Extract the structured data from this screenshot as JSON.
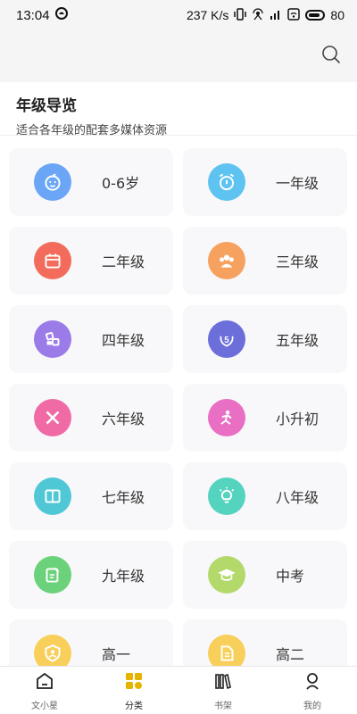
{
  "status_bar": {
    "time": "13:04",
    "net_speed": "237 K/s",
    "battery": "80"
  },
  "header": {
    "title": "年级导览",
    "subtitle": "适合各年级的配套多媒体资源"
  },
  "grades": [
    {
      "label": "0-6岁",
      "icon": "baby-face-icon",
      "color": "#6aa6f5"
    },
    {
      "label": "一年级",
      "icon": "alarm-clock-icon",
      "color": "#5ec3f0"
    },
    {
      "label": "二年级",
      "icon": "calendar-icon",
      "color": "#f26b5b"
    },
    {
      "label": "三年级",
      "icon": "group-people-icon",
      "color": "#f6a15f"
    },
    {
      "label": "四年级",
      "icon": "blocks-icon",
      "color": "#9b7be8"
    },
    {
      "label": "五年级",
      "icon": "laurel-five-icon",
      "color": "#6c6fd9"
    },
    {
      "label": "六年级",
      "icon": "pencil-ruler-icon",
      "color": "#f06aa6"
    },
    {
      "label": "小升初",
      "icon": "running-figure-icon",
      "color": "#e96fc4"
    },
    {
      "label": "七年级",
      "icon": "book-icon",
      "color": "#4fc7d4"
    },
    {
      "label": "八年级",
      "icon": "lightbulb-icon",
      "color": "#54d3bf"
    },
    {
      "label": "九年级",
      "icon": "note-pen-icon",
      "color": "#6bd17a"
    },
    {
      "label": "中考",
      "icon": "graduation-cap-icon",
      "color": "#b3d96a"
    },
    {
      "label": "高一",
      "icon": "shield-person-icon",
      "color": "#f8cf5a"
    },
    {
      "label": "高二",
      "icon": "document-icon",
      "color": "#f8cf5a"
    }
  ],
  "bottom_nav": [
    {
      "label": "文小星",
      "icon": "home-icon",
      "active": false
    },
    {
      "label": "分类",
      "icon": "category-icon",
      "active": true
    },
    {
      "label": "书架",
      "icon": "bookshelf-icon",
      "active": false
    },
    {
      "label": "我的",
      "icon": "profile-icon",
      "active": false
    }
  ]
}
